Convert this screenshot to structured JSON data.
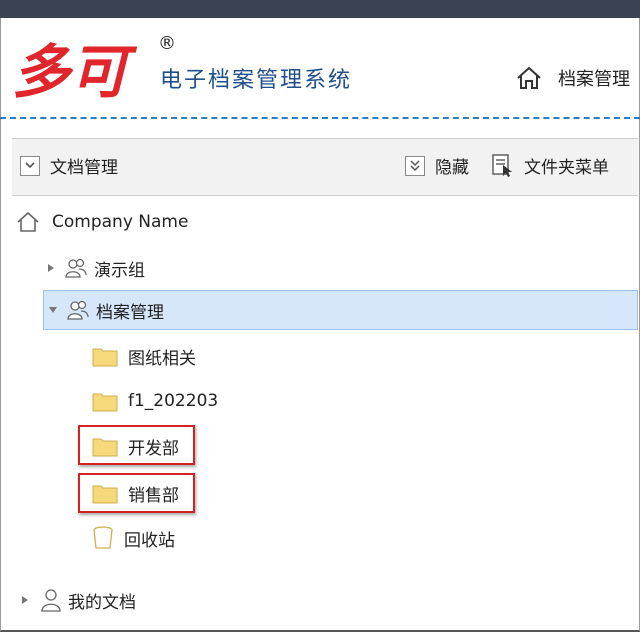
{
  "app": {
    "logo_text": "多可",
    "registered_mark": "®",
    "system_title": "电子档案管理系统",
    "nav_home_label": "档案管理"
  },
  "toolbar": {
    "dropdown_label": "文档管理",
    "hide_label": "隐藏",
    "folder_menu_label": "文件夹菜单"
  },
  "tree": {
    "root": {
      "label": "Company Name",
      "icon": "home-icon"
    },
    "items": [
      {
        "label": "演示组",
        "icon": "group-icon",
        "expanded": false
      },
      {
        "label": "档案管理",
        "icon": "group-icon",
        "expanded": true,
        "selected": true
      },
      {
        "label": "图纸相关",
        "icon": "folder-icon"
      },
      {
        "label": "f1_202203",
        "icon": "folder-icon"
      },
      {
        "label": "开发部",
        "icon": "folder-icon",
        "highlighted": true
      },
      {
        "label": "销售部",
        "icon": "folder-icon",
        "highlighted": true
      },
      {
        "label": "回收站",
        "icon": "recycle-bin-icon"
      },
      {
        "label": "我的文档",
        "icon": "user-icon",
        "expanded": false
      }
    ]
  },
  "colors": {
    "brand_red": "#e0262b",
    "title_blue": "#1f4e8c",
    "selection_bg": "#d6e7fb",
    "highlight_red": "#d42121",
    "folder_yellow": "#f6d97a"
  }
}
